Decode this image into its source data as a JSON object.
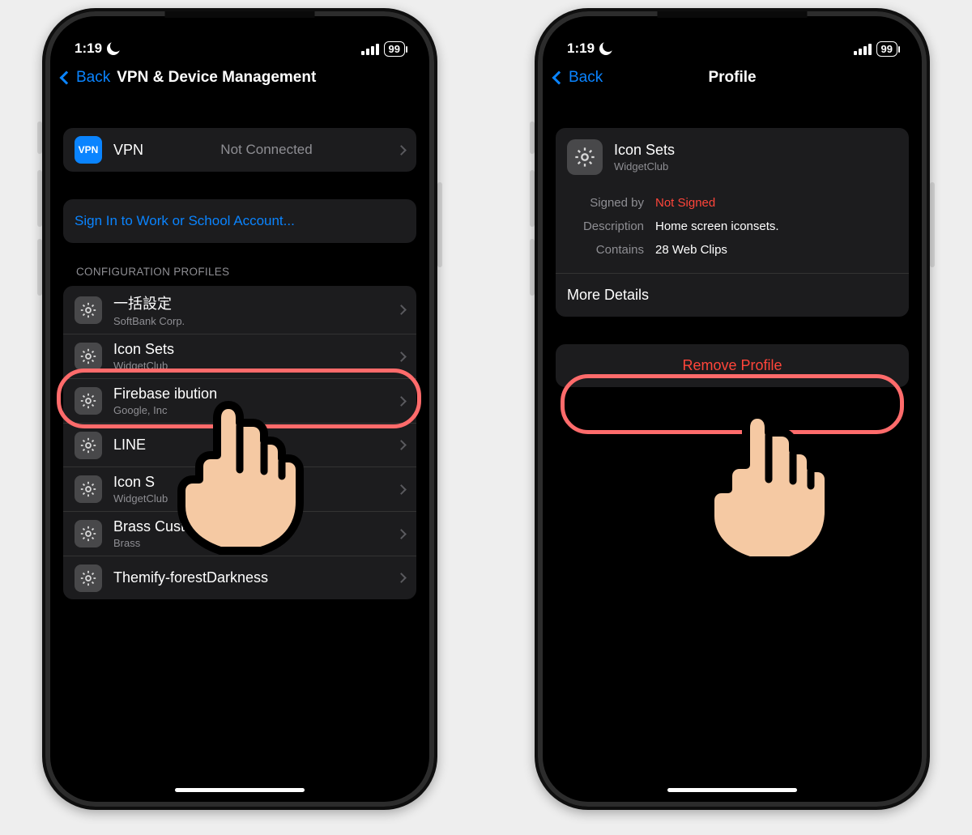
{
  "status": {
    "time": "1:19",
    "battery": "99"
  },
  "left": {
    "back": "Back",
    "title": "VPN & Device Management",
    "vpn": {
      "badge": "VPN",
      "label": "VPN",
      "status": "Not Connected"
    },
    "signin": "Sign In to Work or School Account...",
    "section_header": "CONFIGURATION PROFILES",
    "profiles": [
      {
        "title": "一括設定",
        "sub": "SoftBank Corp."
      },
      {
        "title": "Icon Sets",
        "sub": "WidgetClub"
      },
      {
        "title": "Firebase           ibution",
        "sub": "Google, Inc"
      },
      {
        "title": "LINE",
        "sub": ""
      },
      {
        "title": "Icon S",
        "sub": "WidgetClub"
      },
      {
        "title": "Brass Custom Icons",
        "sub": "Brass"
      },
      {
        "title": "Themify-forestDarkness",
        "sub": ""
      }
    ]
  },
  "right": {
    "back": "Back",
    "title": "Profile",
    "profile": {
      "title": "Icon Sets",
      "sub": "WidgetClub"
    },
    "info": {
      "signed_label": "Signed by",
      "signed_value": "Not Signed",
      "desc_label": "Description",
      "desc_value": "Home screen iconsets.",
      "contains_label": "Contains",
      "contains_value": "28 Web Clips"
    },
    "more_details": "More Details",
    "remove": "Remove Profile"
  }
}
